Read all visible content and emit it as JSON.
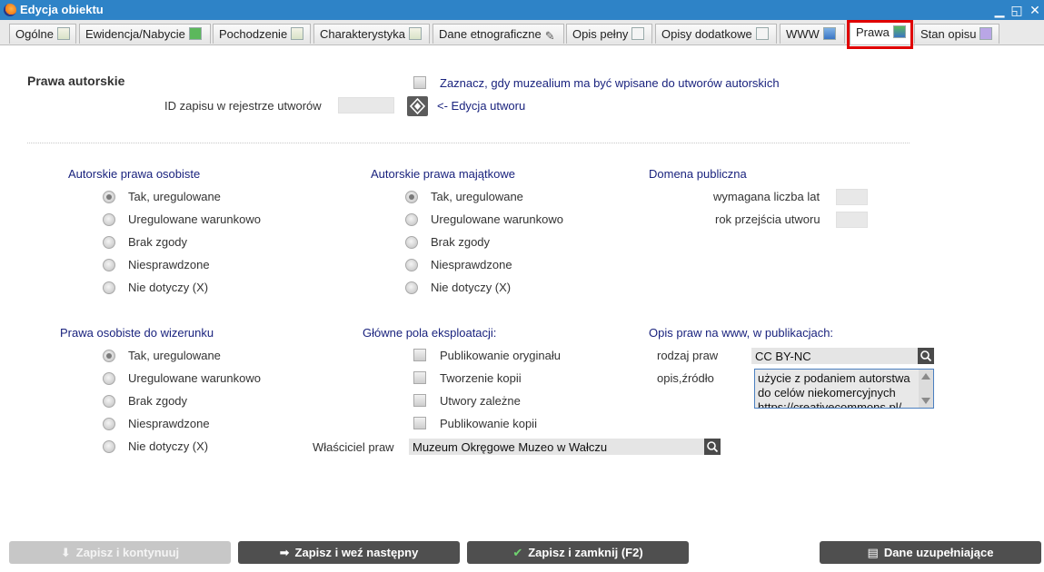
{
  "window": {
    "title": "Edycja obiektu",
    "minimize": "▁",
    "restore": "◱",
    "close": "✕"
  },
  "tabs": [
    {
      "label": "Ogólne",
      "icon": "grid-doc-icon"
    },
    {
      "label": "Ewidencja/Nabycie",
      "icon": "green-arrow-down-icon"
    },
    {
      "label": "Pochodzenie",
      "icon": "list-doc-icon"
    },
    {
      "label": "Charakterystyka",
      "icon": "list-doc-icon"
    },
    {
      "label": "Dane etnograficzne",
      "icon": "pencil-icon"
    },
    {
      "label": "Opis pełny",
      "icon": "text-doc-icon"
    },
    {
      "label": "Opisy dodatkowe",
      "icon": "text-doc-icon"
    },
    {
      "label": "WWW",
      "icon": "globe-icon"
    },
    {
      "label": "Prawa",
      "icon": "rights-icon",
      "active": true
    },
    {
      "label": "Stan opisu",
      "icon": "purple-doc-icon"
    }
  ],
  "copyright": {
    "section_title": "Prawa autorskie",
    "checkbox_label": "Zaznacz, gdy muzealium ma być wpisane do utworów autorskich",
    "registry_id_label": "ID zapisu w rejestrze utworów",
    "edit_link": "<- Edycja utworu"
  },
  "personal_rights": {
    "title": "Autorskie prawa osobiste",
    "options": [
      "Tak, uregulowane",
      "Uregulowane warunkowo",
      "Brak zgody",
      "Niesprawdzone",
      "Nie dotyczy (X)"
    ],
    "selected": 0
  },
  "property_rights": {
    "title": "Autorskie prawa majątkowe",
    "options": [
      "Tak, uregulowane",
      "Uregulowane warunkowo",
      "Brak zgody",
      "Niesprawdzone",
      "Nie dotyczy (X)"
    ],
    "selected": 0
  },
  "public_domain": {
    "title": "Domena publiczna",
    "years_label": "wymagana liczba lat",
    "year_label": "rok przejścia utworu"
  },
  "image_rights": {
    "title": "Prawa osobiste do wizerunku",
    "options": [
      "Tak, uregulowane",
      "Uregulowane warunkowo",
      "Brak zgody",
      "Niesprawdzone",
      "Nie dotyczy (X)"
    ],
    "selected": 0
  },
  "exploitation": {
    "title": "Główne pola eksploatacji:",
    "options": [
      "Publikowanie oryginału",
      "Tworzenie kopii",
      "Utwory zależne",
      "Publikowanie kopii"
    ]
  },
  "owner": {
    "label": "Właściciel praw",
    "value": "Muzeum Okręgowe Muzeo w Wałczu"
  },
  "web_rights": {
    "title": "Opis praw na www, w publikacjach:",
    "type_label": "rodzaj praw",
    "type_value": "CC BY-NC",
    "desc_label": "opis,źródło",
    "desc_value": "użycie z podaniem autorstwa do celów niekomercyjnych https://creativecommons.pl/"
  },
  "buttons": {
    "save_continue": "Zapisz i kontynuuj",
    "save_next": "Zapisz i weź następny",
    "save_close": "Zapisz i zamknij (F2)",
    "extra": "Dane uzupełniające"
  },
  "colors": {
    "titlebar": "#2e83c7",
    "group_title": "#1a237e",
    "highlight": "#e00000",
    "button": "#4f4f4f"
  }
}
